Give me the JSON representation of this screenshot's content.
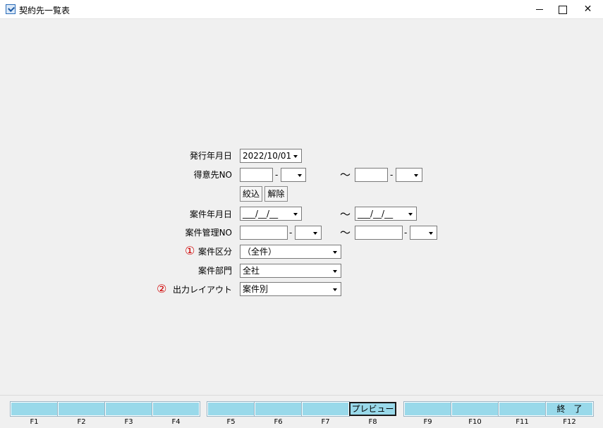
{
  "window": {
    "title": "契約先一覧表"
  },
  "form": {
    "issue_date": {
      "label": "発行年月日",
      "value": "2022/10/01"
    },
    "customer_no": {
      "label": "得意先NO",
      "from_a": "",
      "from_b": "",
      "to_a": "",
      "to_b": "",
      "dash": "-",
      "tilde": "～"
    },
    "filter_button": "絞込",
    "clear_button": "解除",
    "case_date": {
      "label": "案件年月日",
      "from": "___/__/__",
      "to": "___/__/__",
      "tilde": "～"
    },
    "case_no": {
      "label": "案件管理NO",
      "from_a": "",
      "from_b": "",
      "to_a": "",
      "to_b": "",
      "dash": "-",
      "tilde": "～"
    },
    "case_type": {
      "marker": "①",
      "label": "案件区分",
      "value": "（全件）"
    },
    "case_dept": {
      "label": "案件部門",
      "value": "全社"
    },
    "output_layout": {
      "marker": "②",
      "label": "出力レイアウト",
      "value": "案件別"
    }
  },
  "function_keys": [
    {
      "key": "F1",
      "label": ""
    },
    {
      "key": "F2",
      "label": ""
    },
    {
      "key": "F3",
      "label": ""
    },
    {
      "key": "F4",
      "label": ""
    },
    {
      "key": "F5",
      "label": ""
    },
    {
      "key": "F6",
      "label": ""
    },
    {
      "key": "F7",
      "label": ""
    },
    {
      "key": "F8",
      "label": "プレビュー"
    },
    {
      "key": "F9",
      "label": ""
    },
    {
      "key": "F10",
      "label": ""
    },
    {
      "key": "F11",
      "label": ""
    },
    {
      "key": "F12",
      "label": "終　了"
    }
  ],
  "colors": {
    "fkey_bg": "#99d9ea",
    "marker": "#d00000"
  }
}
